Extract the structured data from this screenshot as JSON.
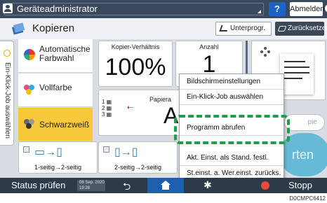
{
  "topbar": {
    "user_label": "Geräteadministrator",
    "help_label": "?",
    "logout_label": "Abmelden"
  },
  "header": {
    "title": "Kopieren",
    "interrupt_label": "Unterprogr.",
    "reset_label": "Zurücksetzen"
  },
  "side_tab": {
    "label": "Ein-Klick-Job auswählen"
  },
  "color_modes": {
    "items": [
      {
        "label": "Automatische Farbwahl",
        "icon": "auto-color-icon",
        "selected": false
      },
      {
        "label": "Vollfarbe",
        "icon": "full-color-icon",
        "selected": false
      },
      {
        "label": "Schwarzweiß",
        "icon": "black-white-icon",
        "selected": true
      }
    ],
    "selected_color": "#f6c83a"
  },
  "tiles": {
    "ratio": {
      "caption": "Kopier-Verhältnis",
      "value": "100%"
    },
    "quantity": {
      "caption": "Anzahl",
      "value": "1"
    },
    "paper": {
      "caption": "Papiera",
      "value": "Aut",
      "trays": "1\n2\n3"
    }
  },
  "sort_button": {
    "label": "pie"
  },
  "functions": [
    {
      "label": "1-seitig→2-seitig"
    },
    {
      "label": "2-seitig→2-seitig"
    }
  ],
  "start_button": {
    "label": "rten"
  },
  "menu": {
    "items": [
      {
        "label": "Bildschirmeinstellungen"
      },
      {
        "label": "Ein-Klick-Job auswählen"
      },
      {
        "label": "Programm abrufen",
        "highlighted": true
      },
      {
        "label": "Akt. Einst. als Stand. festl."
      },
      {
        "label": "St.einst. a. Wer.einst. zurücks."
      }
    ],
    "highlight_color": "#1f9d4a"
  },
  "bottombar": {
    "status_label": "Status prüfen",
    "date": "08 Sep. 2020",
    "time": "19:28",
    "stop_label": "Stopp"
  },
  "footer": {
    "code": "D0CMPC6412"
  }
}
